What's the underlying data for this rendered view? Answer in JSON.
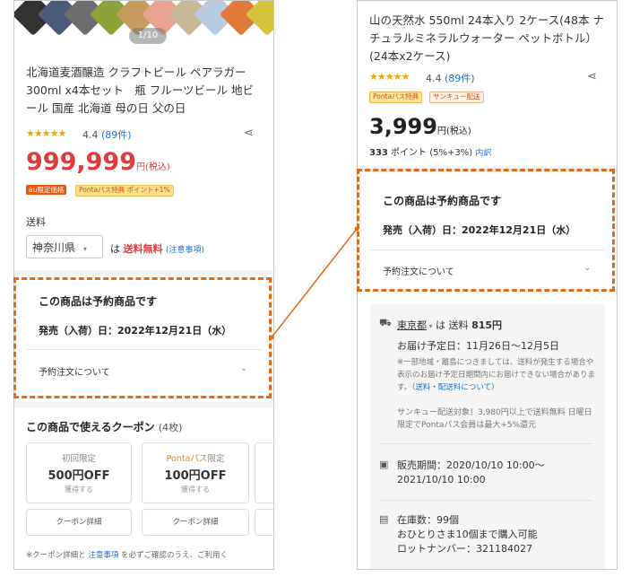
{
  "left": {
    "image_counter": "1/10",
    "swatch_colors": [
      "#333333",
      "#4b5a7a",
      "#6d6d6d",
      "#8aa336",
      "#c79a5e",
      "#e9a38e",
      "#c8b999",
      "#b9cbe0",
      "#e07a3a",
      "#d6c23a"
    ],
    "title": "北海道麦酒醸造 クラフトビール ペアラガー 300ml x4本セット　瓶 フルーツビール 地ビール 国産 北海道 母の日 父の日",
    "stars": "★★★★★",
    "rating_value": "4.4",
    "rating_count": "(89件)",
    "price": "999,999",
    "price_tax": "円(税込)",
    "badge_au": "au限定価格",
    "badge_ponta": "Pontaパス特典 ポイント+1%",
    "shipping_label": "送料",
    "prefecture": "神奈川県",
    "free_prefix": "は",
    "free_text": "送料無料",
    "free_note": "(注意事項)",
    "preorder_title": "この商品は予約商品です",
    "preorder_date": "発売（入荷）日：2022年12月21日（水）",
    "preorder_accordion": "予約注文について",
    "coupon_title": "この商品で使えるクーポン",
    "coupon_count": "(4枚)",
    "coupons": [
      {
        "tag": "初回限定",
        "tag_orange": "",
        "tag_rest": "",
        "amount": "500円OFF",
        "action": "獲得する",
        "detail": "クーポン詳細"
      },
      {
        "tag": "",
        "tag_orange": "Pontaパス",
        "tag_rest": "限定",
        "amount": "100円OFF",
        "action": "獲得する",
        "detail": "クーポン詳細"
      }
    ],
    "note_a": "※クーポン詳細と ",
    "note_link": "注意事項",
    "note_b": " を必ずご確認のうえ、ご利用く"
  },
  "right": {
    "title": "山の天然水 550ml 24本入り 2ケース(48本 ナチュラルミネラルウォーター ペットボトル）(24本x2ケース)",
    "stars": "★★★★★",
    "rating_value": "4.4",
    "rating_count": "(89件)",
    "badge_ponta": "Pontaパス特典",
    "badge_thanks": "サンキュー配送",
    "price": "3,999",
    "price_tax": "円(税込)",
    "points_num": "333",
    "points_text": " ポイント (5%+3%) ",
    "points_link": "内訳",
    "preorder_title": "この商品は予約商品です",
    "preorder_date": "発売（入荷）日：2022年12月21日（水）",
    "preorder_accordion": "予約注文について",
    "ship_pref": "東京都",
    "ship_mid": " は 送料 ",
    "ship_price": "815円",
    "delivery": "お届け予定日：11月26日〜12月5日",
    "ship_note": "※一部地域・離島につきましては、送料が発生する場合や表示のお届け予定日期間内にお届けできない場合があります。",
    "ship_note_link": "（送料・配送料について）",
    "thanks_note": "サンキュー配送対象！3,980円以上で送料無料 日曜日限定でPontaパス会員は最大+5%還元",
    "sales_period": "販売期間：2020/10/10 10:00〜 2021/10/10 10:00",
    "stock_line1": "在庫数：99個",
    "stock_line2": "おひとりさま10個まで購入可能",
    "stock_line3": "ロットナンバー：321184027"
  },
  "colors": {
    "accent_red": "#e03a3a",
    "dash_orange": "#e46a1a",
    "link_blue": "#1e6fc8",
    "star": "#f0a500"
  }
}
